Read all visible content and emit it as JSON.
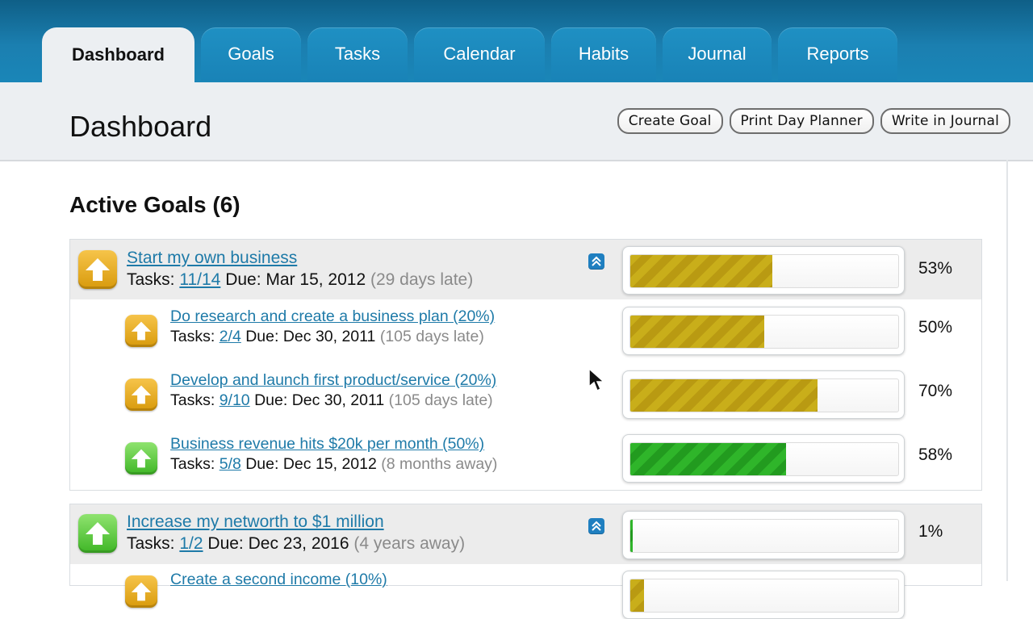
{
  "nav": {
    "tabs": [
      {
        "label": "Dashboard",
        "active": true
      },
      {
        "label": "Goals"
      },
      {
        "label": "Tasks"
      },
      {
        "label": "Calendar"
      },
      {
        "label": "Habits"
      },
      {
        "label": "Journal"
      },
      {
        "label": "Reports"
      }
    ]
  },
  "header": {
    "title": "Dashboard",
    "buttons": {
      "create_goal": "Create Goal",
      "print_day_planner": "Print Day Planner",
      "write_in_journal": "Write in Journal"
    }
  },
  "active_goals": {
    "title": "Active Goals (6)",
    "colors": {
      "behind": "#d89a0c",
      "on_track": "#3fb626",
      "link": "#1e7aa8",
      "late_text": "#8a8a8a"
    },
    "goals": [
      {
        "title": "Start my own business",
        "tasks_label": "Tasks:",
        "tasks": "11/14",
        "due_label": "Due:",
        "due": "Mar 15, 2012",
        "status": "(29 days late)",
        "percent_label": "53%",
        "progress": 0.53,
        "icon": "up-arrow-icon",
        "color": "orange",
        "subgoals": [
          {
            "title": "Do research and create a business plan (20%)",
            "tasks_label": "Tasks:",
            "tasks": "2/4",
            "due_label": "Due:",
            "due": "Dec 30, 2011",
            "status": "(105 days late)",
            "percent_label": "50%",
            "progress": 0.5,
            "icon": "up-arrow-icon",
            "color": "orange"
          },
          {
            "title": "Develop and launch first product/service (20%)",
            "tasks_label": "Tasks:",
            "tasks": "9/10",
            "due_label": "Due:",
            "due": "Dec 30, 2011",
            "status": "(105 days late)",
            "percent_label": "70%",
            "progress": 0.7,
            "icon": "up-arrow-icon",
            "color": "orange"
          },
          {
            "title": "Business revenue hits $20k per month (50%)",
            "tasks_label": "Tasks:",
            "tasks": "5/8",
            "due_label": "Due:",
            "due": "Dec 15, 2012",
            "status": "(8 months away)",
            "percent_label": "58%",
            "progress": 0.58,
            "icon": "up-arrow-icon",
            "color": "green"
          }
        ]
      },
      {
        "title": "Increase my networth to $1 million",
        "tasks_label": "Tasks:",
        "tasks": "1/2",
        "due_label": "Due:",
        "due": "Dec 23, 2016",
        "status": "(4 years away)",
        "percent_label": "1%",
        "progress": 0.01,
        "icon": "up-arrow-icon",
        "color": "green",
        "subgoals": [
          {
            "title": "Create a second income (10%)",
            "progress": 0.05,
            "icon": "up-arrow-icon",
            "color": "orange"
          }
        ]
      }
    ]
  }
}
